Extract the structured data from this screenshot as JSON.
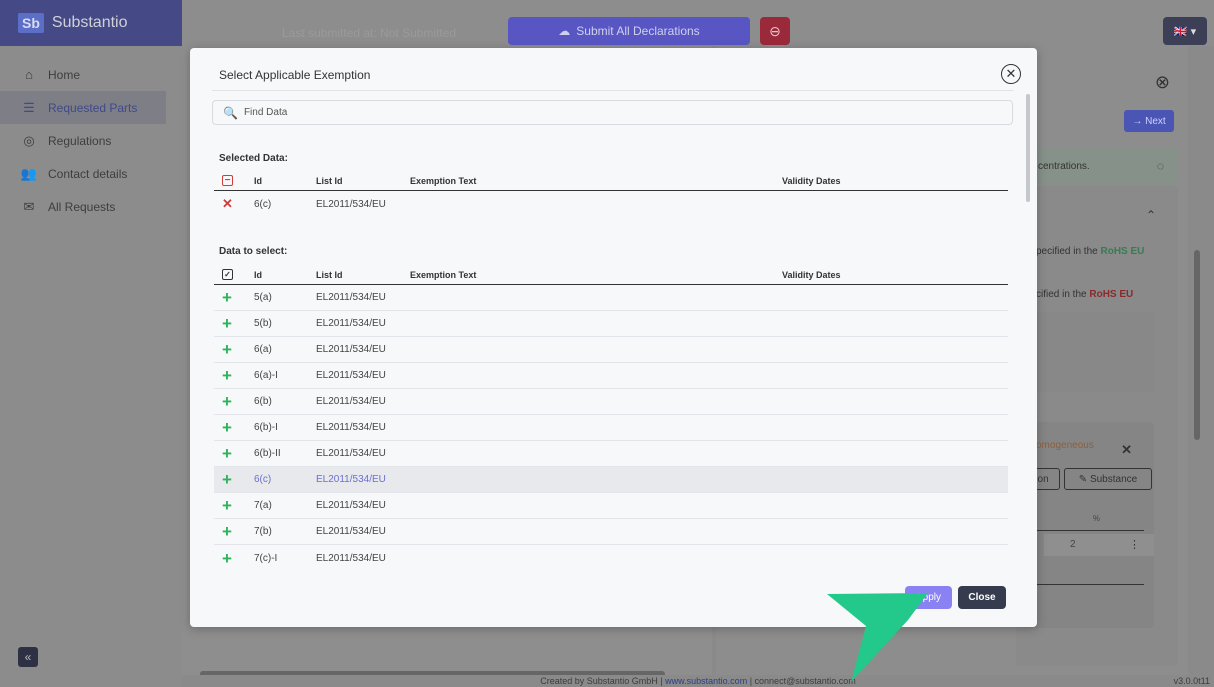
{
  "app": {
    "logo": "Sb",
    "name": "Substantio",
    "last_submitted": "Last submitted at: Not Submitted",
    "submit_all": "Submit All Declarations",
    "language_flag": "🇬🇧 ▾"
  },
  "sidebar": {
    "items": [
      {
        "label": "Home",
        "icon": "home-icon",
        "glyph": "⌂"
      },
      {
        "label": "Requested Parts",
        "icon": "list-icon",
        "glyph": "☰"
      },
      {
        "label": "Regulations",
        "icon": "shield-icon",
        "glyph": "◎"
      },
      {
        "label": "Contact details",
        "icon": "contacts-icon",
        "glyph": "👥"
      },
      {
        "label": "All Requests",
        "icon": "envelope-icon",
        "glyph": "✉"
      }
    ],
    "collapse": "«"
  },
  "right_panel": {
    "next": "→ Next",
    "info": "centrations.",
    "line1_prefix": "pecified in the ",
    "line1_tag": "RoHS EU",
    "line2_prefix": "cified in the ",
    "line2_tag": "RoHS EU",
    "homogeneous": "omogeneous",
    "btn_ion": "ion",
    "btn_substance": "✎ Substance",
    "pct_header": "%",
    "pct_value": "2"
  },
  "footer": {
    "text": "Created by Substantio GmbH | ",
    "link": "www.substantio.com",
    "email": " | connect@substantio.com",
    "version": "v3.0.0t11"
  },
  "modal": {
    "title": "Select Applicable Exemption",
    "search_placeholder": "Find Data",
    "selected_label": "Selected Data:",
    "to_select_label": "Data to select:",
    "columns": {
      "id": "Id",
      "list_id": "List Id",
      "exemption_text": "Exemption Text",
      "validity_dates": "Validity Dates"
    },
    "selected_rows": [
      {
        "id": "6(c)",
        "list_id": "EL2011/534/EU",
        "exemption_text": "",
        "validity_dates": ""
      }
    ],
    "rows": [
      {
        "id": "5(a)",
        "list_id": "EL2011/534/EU",
        "exemption_text": "",
        "validity_dates": ""
      },
      {
        "id": "5(b)",
        "list_id": "EL2011/534/EU",
        "exemption_text": "",
        "validity_dates": ""
      },
      {
        "id": "6(a)",
        "list_id": "EL2011/534/EU",
        "exemption_text": "",
        "validity_dates": ""
      },
      {
        "id": "6(a)-I",
        "list_id": "EL2011/534/EU",
        "exemption_text": "",
        "validity_dates": ""
      },
      {
        "id": "6(b)",
        "list_id": "EL2011/534/EU",
        "exemption_text": "",
        "validity_dates": ""
      },
      {
        "id": "6(b)-I",
        "list_id": "EL2011/534/EU",
        "exemption_text": "",
        "validity_dates": ""
      },
      {
        "id": "6(b)-II",
        "list_id": "EL2011/534/EU",
        "exemption_text": "",
        "validity_dates": ""
      },
      {
        "id": "6(c)",
        "list_id": "EL2011/534/EU",
        "exemption_text": "",
        "validity_dates": "",
        "highlighted": true
      },
      {
        "id": "7(a)",
        "list_id": "EL2011/534/EU",
        "exemption_text": "",
        "validity_dates": ""
      },
      {
        "id": "7(b)",
        "list_id": "EL2011/534/EU",
        "exemption_text": "",
        "validity_dates": ""
      },
      {
        "id": "7(c)-I",
        "list_id": "EL2011/534/EU",
        "exemption_text": "",
        "validity_dates": ""
      }
    ],
    "apply": "Apply",
    "close": "Close"
  },
  "colors": {
    "accent": "#8a82f3",
    "add": "#2fb35a",
    "remove": "#d33a3a",
    "dark_button": "#363c4e",
    "pointer": "#22c98a"
  }
}
